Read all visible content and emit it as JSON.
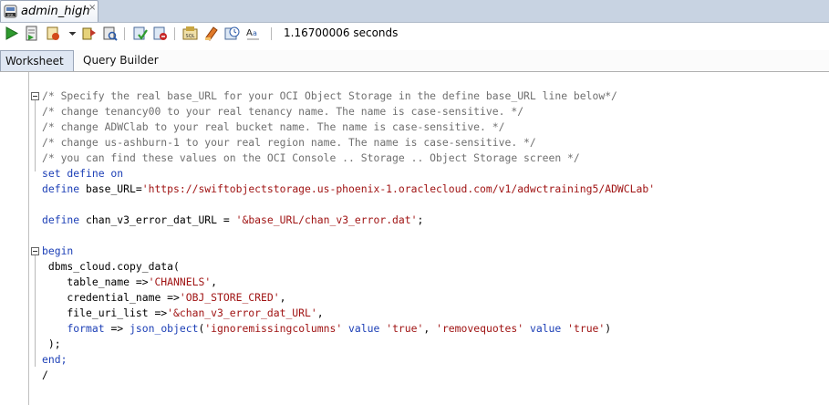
{
  "tab": {
    "title": "admin_high",
    "close": "×"
  },
  "toolbar": {
    "buttons": [
      "run-statement-icon",
      "run-script-icon",
      "explain-plan-icon",
      "dropdown-arrow-icon",
      "autotrace-icon",
      "sql-tuning-icon",
      "commit-icon",
      "rollback-icon",
      "unshared-sql-icon",
      "clear-icon",
      "history-icon",
      "format-icon"
    ],
    "timing": "1.16700006 seconds"
  },
  "subtabs": {
    "worksheet": "Worksheet",
    "query_builder": "Query Builder"
  },
  "code": {
    "l1": "/* Specify the real base_URL for your OCI Object Storage in the define base_URL line below*/",
    "l2": "/* change tenancy00 to your real tenancy name. The name is case-sensitive. */",
    "l3": "/* change ADWClab to your real bucket name. The name is case-sensitive. */",
    "l4": "/* change us-ashburn-1 to your real region name. The name is case-sensitive. */",
    "l5": "/* you can find these values on the OCI Console .. Storage .. Object Storage screen */",
    "l6": "set define on",
    "l7_kw": "define",
    "l7_pl": " base_URL=",
    "l7_str": "'https://swiftobjectstorage.us-phoenix-1.oraclecloud.com/v1/adwctraining5/ADWCLab'",
    "l9_kw": "define",
    "l9_pl": " chan_v3_error_dat_URL = ",
    "l9_str": "'&base_URL/chan_v3_error.dat'",
    "l9_end": ";",
    "l11": "begin",
    "l12": " dbms_cloud.copy_data(",
    "l13_pl": "    table_name =>",
    "l13_str": "'CHANNELS'",
    "l13_end": ",",
    "l14_pl": "    credential_name =>",
    "l14_str": "'OBJ_STORE_CRED'",
    "l14_end": ",",
    "l15_pl": "    file_uri_list =>",
    "l15_str": "'&chan_v3_error_dat_URL'",
    "l15_end": ",",
    "l16_kw1": "format",
    "l16_pl1": " => ",
    "l16_kw2": "json_object",
    "l16_pl2": "(",
    "l16_s1": "'ignoremissingcolumns'",
    "l16_kw3": " value ",
    "l16_s2": "'true'",
    "l16_pl3": ", ",
    "l16_s3": "'removequotes'",
    "l16_kw4": " value ",
    "l16_s4": "'true'",
    "l16_pl4": ")",
    "l17": " );",
    "l18": "end;",
    "l19": "/"
  }
}
